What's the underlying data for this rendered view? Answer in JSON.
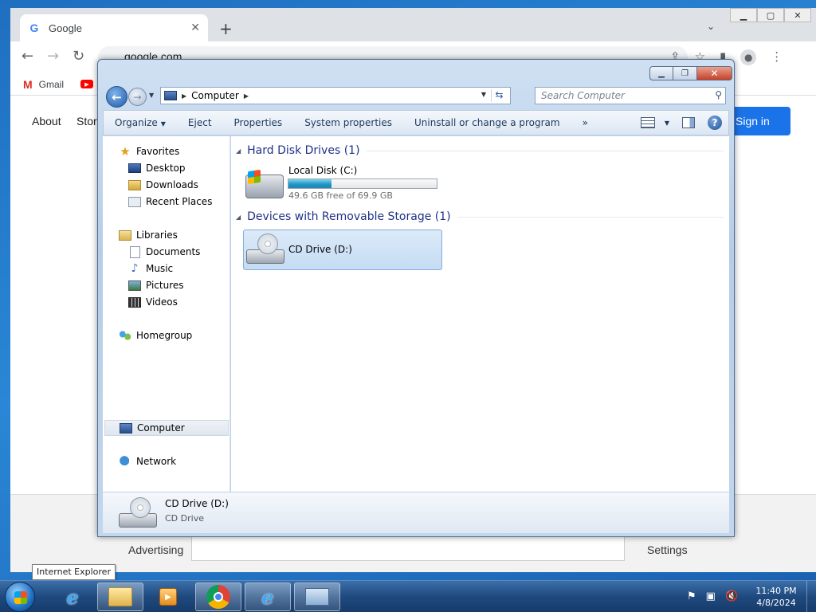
{
  "chrome": {
    "tab_title": "Google",
    "url": "google.com",
    "bookmarks": {
      "gmail": "Gmail"
    },
    "nav": {
      "about": "About",
      "store": "Store"
    },
    "sign_in": "Sign in",
    "footer": {
      "advertising": "Advertising",
      "settings": "Settings"
    }
  },
  "explorer": {
    "address": {
      "location": "Computer"
    },
    "search": {
      "placeholder": "Search Computer"
    },
    "commands": {
      "organize": "Organize",
      "eject": "Eject",
      "properties": "Properties",
      "system_properties": "System properties",
      "uninstall": "Uninstall or change a program",
      "more": "»"
    },
    "nav_pane": {
      "favorites": {
        "label": "Favorites",
        "items": [
          "Desktop",
          "Downloads",
          "Recent Places"
        ]
      },
      "libraries": {
        "label": "Libraries",
        "items": [
          "Documents",
          "Music",
          "Pictures",
          "Videos"
        ]
      },
      "homegroup": "Homegroup",
      "computer": "Computer",
      "network": "Network"
    },
    "groups": {
      "hdd": {
        "title": "Hard Disk Drives (1)",
        "drive_name": "Local Disk (C:)",
        "free_text": "49.6 GB free of 69.9 GB",
        "used_fraction": 0.29
      },
      "removable": {
        "title": "Devices with Removable Storage (1)",
        "drive_name": "CD Drive (D:)"
      }
    },
    "details": {
      "title": "CD Drive (D:)",
      "subtitle": "CD Drive"
    }
  },
  "tooltip": "Internet Explorer",
  "taskbar": {
    "clock_time": "11:40 PM",
    "clock_date": "4/8/2024"
  }
}
